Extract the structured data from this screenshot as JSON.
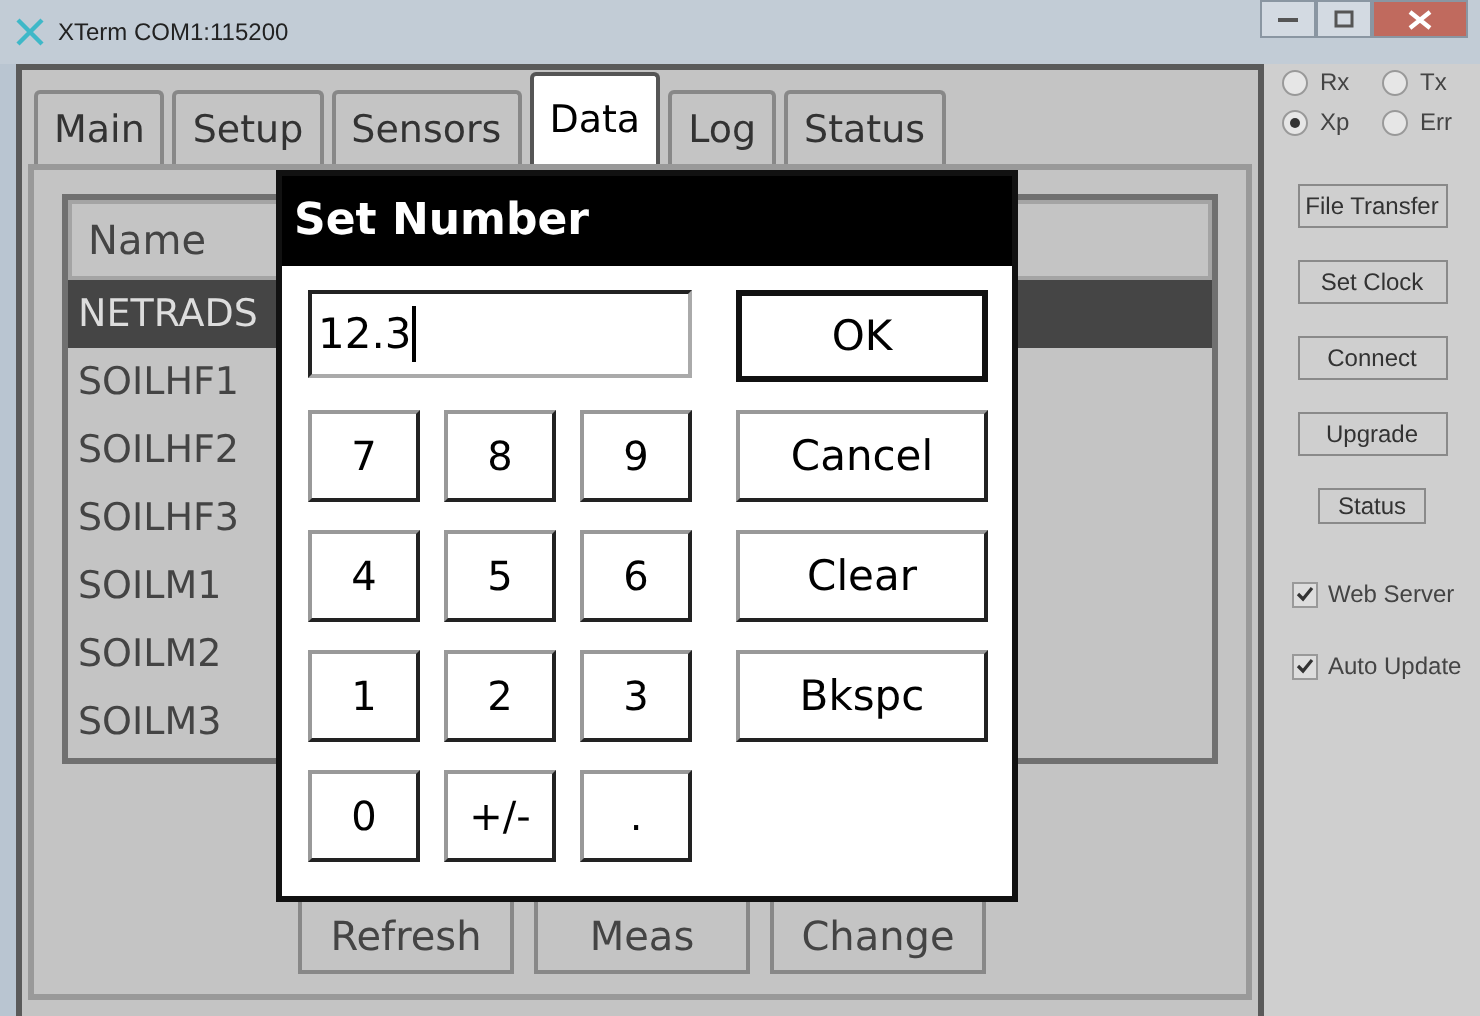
{
  "window": {
    "title": "XTerm COM1:115200"
  },
  "tabs": [
    {
      "label": "Main",
      "selected": false
    },
    {
      "label": "Setup",
      "selected": false
    },
    {
      "label": "Sensors",
      "selected": false
    },
    {
      "label": "Data",
      "selected": true
    },
    {
      "label": "Log",
      "selected": false
    },
    {
      "label": "Status",
      "selected": false
    }
  ],
  "table": {
    "columns": [
      {
        "label": "Name"
      }
    ],
    "rows": [
      {
        "name": "NETRADS",
        "selected": true
      },
      {
        "name": "SOILHF1",
        "selected": false
      },
      {
        "name": "SOILHF2",
        "selected": false
      },
      {
        "name": "SOILHF3",
        "selected": false
      },
      {
        "name": "SOILM1",
        "selected": false
      },
      {
        "name": "SOILM2",
        "selected": false
      },
      {
        "name": "SOILM3",
        "selected": false
      }
    ]
  },
  "buttons": [
    "Refresh",
    "Meas",
    "Change"
  ],
  "indicators": [
    {
      "label": "Rx",
      "selected": false
    },
    {
      "label": "Tx",
      "selected": false
    },
    {
      "label": "Xp",
      "selected": true
    },
    {
      "label": "Err",
      "selected": false
    }
  ],
  "side_buttons": [
    {
      "label": "File Transfer",
      "kind": "wide"
    },
    {
      "label": "Set Clock",
      "kind": "wide"
    },
    {
      "label": "Connect",
      "kind": "wide"
    },
    {
      "label": "Upgrade",
      "kind": "wide"
    },
    {
      "label": "Status",
      "kind": "small"
    }
  ],
  "checkboxes": [
    {
      "label": "Web Server",
      "checked": true
    },
    {
      "label": "Auto Update",
      "checked": true
    }
  ],
  "dialog": {
    "title": "Set Number",
    "value": "12.3",
    "keys": [
      "7",
      "8",
      "9",
      "4",
      "5",
      "6",
      "1",
      "2",
      "3",
      "0",
      "+/-",
      "."
    ],
    "actions": [
      {
        "label": "OK",
        "default": true
      },
      {
        "label": "Cancel",
        "default": false
      },
      {
        "label": "Clear",
        "default": false
      },
      {
        "label": "Bkspc",
        "default": false
      }
    ]
  }
}
